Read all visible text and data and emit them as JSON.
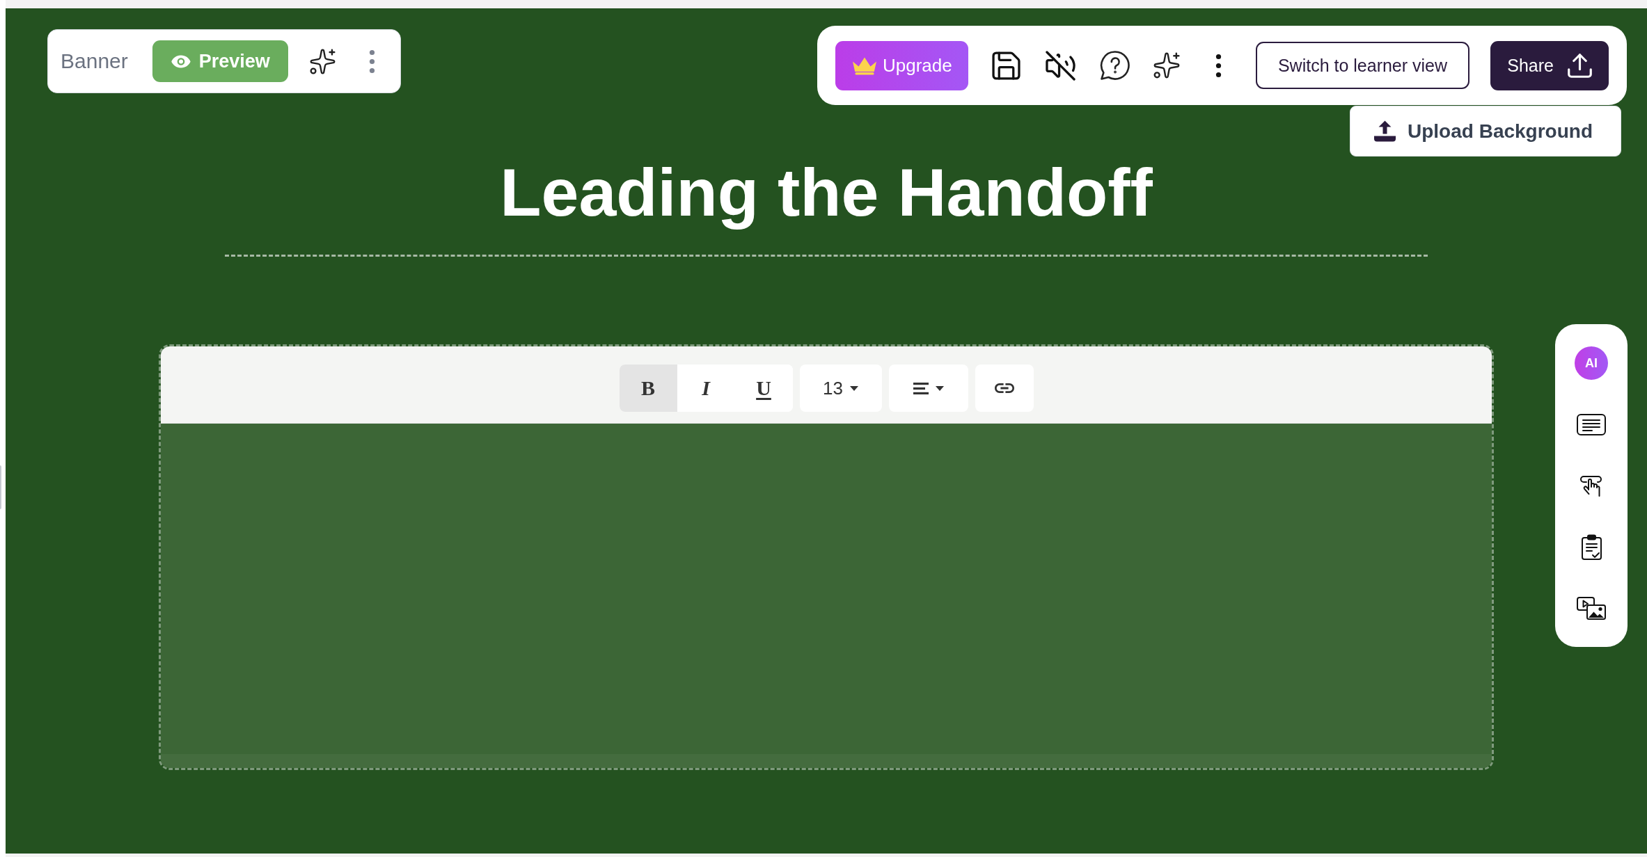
{
  "block_bar": {
    "label": "Banner",
    "preview_button": "Preview"
  },
  "main_toolbar": {
    "upgrade_button": "Upgrade",
    "sound_muted": true,
    "learner_view_button": "Switch to learner view",
    "share_button": "Share"
  },
  "upload_background_button": "Upload Background",
  "title": "Leading the Handoff",
  "editor": {
    "format_buttons": [
      {
        "kind": "bold",
        "label": "B",
        "on": true
      },
      {
        "kind": "italic",
        "label": "I",
        "on": false
      },
      {
        "kind": "underline",
        "label": "U",
        "on": false
      }
    ],
    "font_size": "13"
  },
  "side_panel": {
    "ai_button": "AI"
  }
}
